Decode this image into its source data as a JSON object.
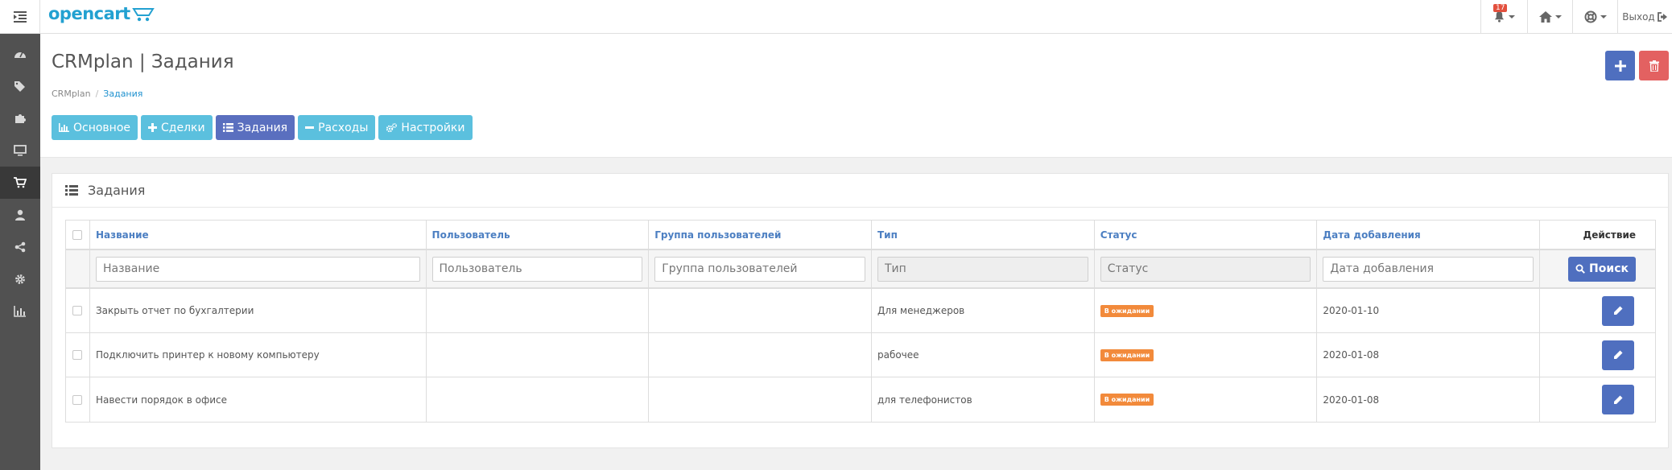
{
  "header": {
    "logo_text": "opencart",
    "notifications_count": "17",
    "logout_label": "Выход"
  },
  "page": {
    "title": "CRMplan | Задания",
    "breadcrumb": [
      "CRMplan",
      "Задания"
    ]
  },
  "tabs": [
    {
      "label": "Основное",
      "icon": "bar-chart-icon"
    },
    {
      "label": "Сделки",
      "icon": "plus-icon"
    },
    {
      "label": "Задания",
      "icon": "list-icon",
      "active": true
    },
    {
      "label": "Расходы",
      "icon": "minus-icon"
    },
    {
      "label": "Настройки",
      "icon": "cogs-icon"
    }
  ],
  "panel": {
    "title": "Задания"
  },
  "table": {
    "headers": {
      "name": "Название",
      "user": "Пользователь",
      "group": "Группа пользователей",
      "type": "Тип",
      "status": "Статус",
      "date": "Дата добавления",
      "action": "Действие"
    },
    "filters": {
      "name_placeholder": "Название",
      "user_placeholder": "Пользователь",
      "group_placeholder": "Группа пользователей",
      "type_placeholder": "Тип",
      "status_placeholder": "Статус",
      "date_placeholder": "Дата добавления",
      "search_label": "Поиск"
    },
    "rows": [
      {
        "name": "Закрыть отчет по бухгалтерии",
        "user": "",
        "group": "",
        "type": "Для менеджеров",
        "status": "В ожидании",
        "date": "2020-01-10"
      },
      {
        "name": "Подключить принтер к новому компьютеру",
        "user": "",
        "group": "",
        "type": "рабочее",
        "status": "В ожидании",
        "date": "2020-01-08"
      },
      {
        "name": "Навести порядок в офисе",
        "user": "",
        "group": "",
        "type": "для телефонистов",
        "status": "В ожидании",
        "date": "2020-01-08"
      }
    ]
  },
  "colors": {
    "primary": "#4f6fbf",
    "info": "#5bc0de",
    "danger": "#e36161",
    "warning": "#f28a3b",
    "sidebar": "#515151",
    "link": "#4c7fc2"
  }
}
